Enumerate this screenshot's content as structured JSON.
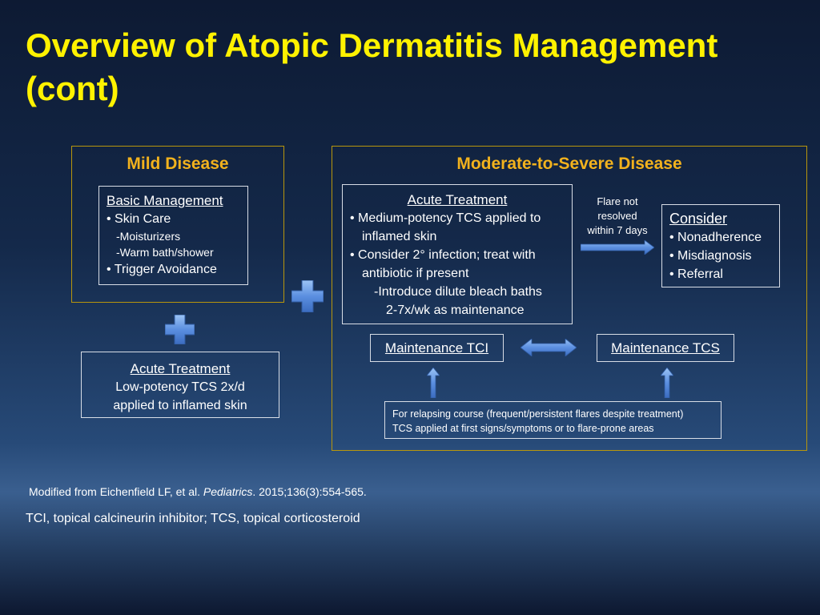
{
  "slide": {
    "title": "Overview of Atopic Dermatitis Management (cont)"
  },
  "mild": {
    "heading": "Mild Disease",
    "basic": {
      "title": "Basic Management",
      "l1": "• Skin Care",
      "l2": "-Moisturizers",
      "l3": "-Warm bath/shower",
      "l4": "• Trigger Avoidance"
    },
    "acute": {
      "title": "Acute Treatment",
      "l1": "Low-potency TCS 2x/d",
      "l2": "applied to inflamed skin"
    }
  },
  "severe": {
    "heading": "Moderate-to-Severe Disease",
    "acute": {
      "title": "Acute Treatment",
      "l1": "• Medium-potency TCS applied to",
      "l2": "inflamed skin",
      "l3": "• Consider 2° infection; treat with",
      "l4": "antibiotic if present",
      "l5": "-Introduce dilute bleach baths",
      "l6": "2-7x/wk as maintenance"
    },
    "flare_label": {
      "l1": "Flare not",
      "l2": "resolved",
      "l3": "within 7 days"
    },
    "consider": {
      "title": "Consider",
      "l1": "• Nonadherence",
      "l2": "• Misdiagnosis",
      "l3": "• Referral"
    },
    "maint_tci": "Maintenance TCI",
    "maint_tcs": "Maintenance TCS",
    "relapse": {
      "l1": "For relapsing course (frequent/persistent flares despite treatment)",
      "l2": "TCS applied at first signs/symptoms or to flare-prone areas"
    }
  },
  "footer": {
    "ref_prefix": "Modified from Eichenfield LF, et al. ",
    "ref_journal": "Pediatrics",
    "ref_suffix": ". 2015;136(3):554-565.",
    "abbrev": "TCI, topical calcineurin inhibitor; TCS, topical corticosteroid"
  },
  "colors": {
    "title": "#fff200",
    "heading": "#f2b21d",
    "frame_border": "#b8960c",
    "arrow": "#6a9be0"
  }
}
